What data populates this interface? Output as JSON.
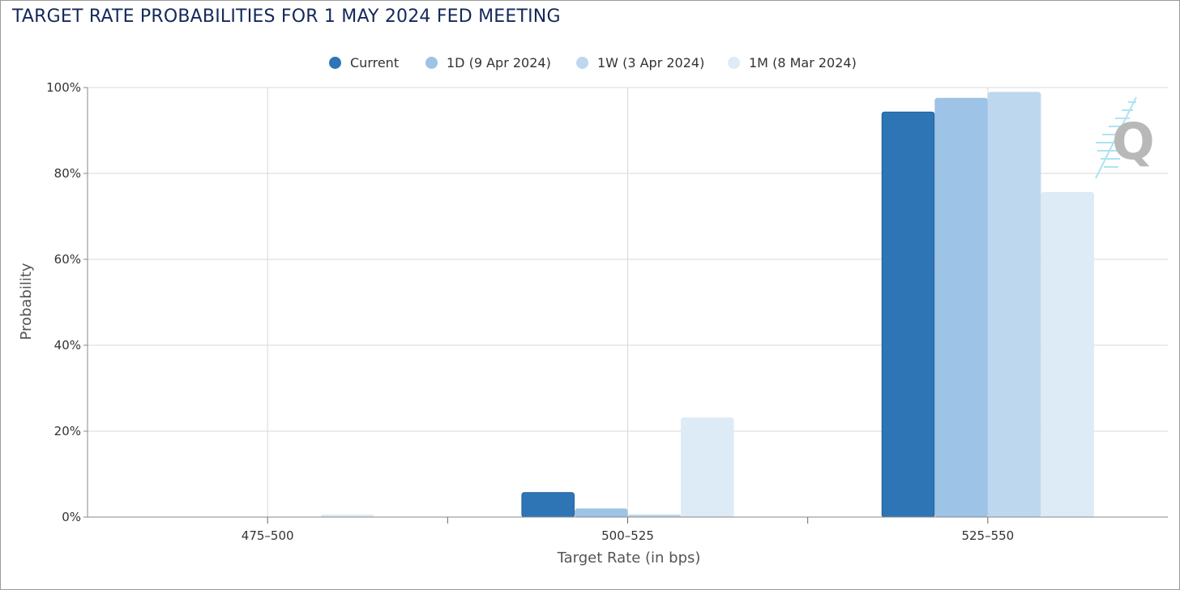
{
  "title": "TARGET RATE PROBABILITIES FOR 1 MAY 2024 FED MEETING",
  "legend": [
    {
      "label": "Current",
      "color": "#2e75b6"
    },
    {
      "label": "1D (9 Apr 2024)",
      "color": "#9dc3e6"
    },
    {
      "label": "1W (3 Apr 2024)",
      "color": "#bdd7ee"
    },
    {
      "label": "1M (8 Mar 2024)",
      "color": "#ddebf7"
    }
  ],
  "chart_data": {
    "type": "bar",
    "xlabel": "Target Rate (in bps)",
    "ylabel": "Probability",
    "categories": [
      "475-500",
      "500-525",
      "525-550"
    ],
    "ylim": [
      0,
      100
    ],
    "yticks": [
      "0%",
      "20%",
      "40%",
      "60%",
      "80%",
      "100%"
    ],
    "ytick_values": [
      0,
      20,
      40,
      60,
      80,
      100
    ],
    "grid": true,
    "legend_position": "top-center",
    "series": [
      {
        "name": "Current",
        "color": "#2e75b6",
        "values": [
          0,
          5.7,
          94.3
        ]
      },
      {
        "name": "1D (9 Apr 2024)",
        "color": "#9dc3e6",
        "values": [
          0,
          1.9,
          97.5
        ]
      },
      {
        "name": "1W (3 Apr 2024)",
        "color": "#bdd7ee",
        "values": [
          0,
          0.5,
          98.9
        ]
      },
      {
        "name": "1M (8 Mar 2024)",
        "color": "#ddebf7",
        "values": [
          0.5,
          23.1,
          75.6
        ]
      }
    ]
  },
  "watermark": {
    "icon": "quikstrike-q-logo"
  }
}
